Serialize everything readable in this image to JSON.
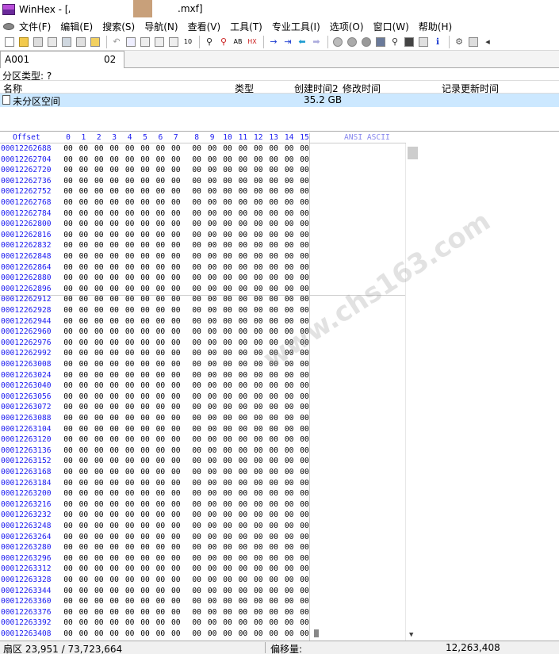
{
  "window": {
    "title_prefix": "WinHex - [A",
    "title_suffix": ".mxf]"
  },
  "menu": [
    {
      "label": "文件(F)"
    },
    {
      "label": "编辑(E)"
    },
    {
      "label": "搜索(S)"
    },
    {
      "label": "导航(N)"
    },
    {
      "label": "查看(V)"
    },
    {
      "label": "工具(T)"
    },
    {
      "label": "专业工具(I)"
    },
    {
      "label": "选项(O)"
    },
    {
      "label": "窗口(W)"
    },
    {
      "label": "帮助(H)"
    }
  ],
  "tab": {
    "label_prefix": "A001",
    "label_suffix": "02"
  },
  "partition": {
    "type_label": "分区类型: ?"
  },
  "directory": {
    "headers": {
      "name": "名称",
      "type": "类型",
      "created": "创建时间2",
      "modified": "修改时间",
      "record_updated": "记录更新时间"
    },
    "rows": [
      {
        "name": "未分区空间",
        "size": "35.2 GB"
      }
    ]
  },
  "hex": {
    "offset_header": "Offset",
    "columns": [
      "0",
      "1",
      "2",
      "3",
      "4",
      "5",
      "6",
      "7",
      "8",
      "9",
      "10",
      "11",
      "12",
      "13",
      "14",
      "15"
    ],
    "ansi_header": "ANSI ASCII",
    "byte_value": "00",
    "offsets": [
      "000122626 88",
      "00012262704",
      "00012262720",
      "00012262736",
      "00012262752",
      "00012262768",
      "00012262784",
      "00012262800",
      "00012262816",
      "00012262832",
      "00012262848",
      "00012262864",
      "00012262880",
      "00012262896",
      "00012262912",
      "00012262928",
      "00012262944",
      "00012262960",
      "00012262976",
      "00012262992",
      "00012263008",
      "00012263024",
      "00012263040",
      "00012263056",
      "00012263072",
      "00012263088",
      "00012263104",
      "00012263120",
      "00012263136",
      "00012263152",
      "00012263168",
      "00012263184",
      "00012263200",
      "00012263216",
      "00012263232",
      "00012263248",
      "00012263264",
      "00012263280",
      "00012263296",
      "00012263312",
      "00012263328",
      "00012263344",
      "00012263360",
      "00012263376",
      "00012263392",
      "00012263408"
    ]
  },
  "status": {
    "sector": "扇区 23,951 / 73,723,664",
    "offset_label": "偏移量:",
    "offset_value": "12,263,408"
  },
  "watermark": "www.chs163.com"
}
